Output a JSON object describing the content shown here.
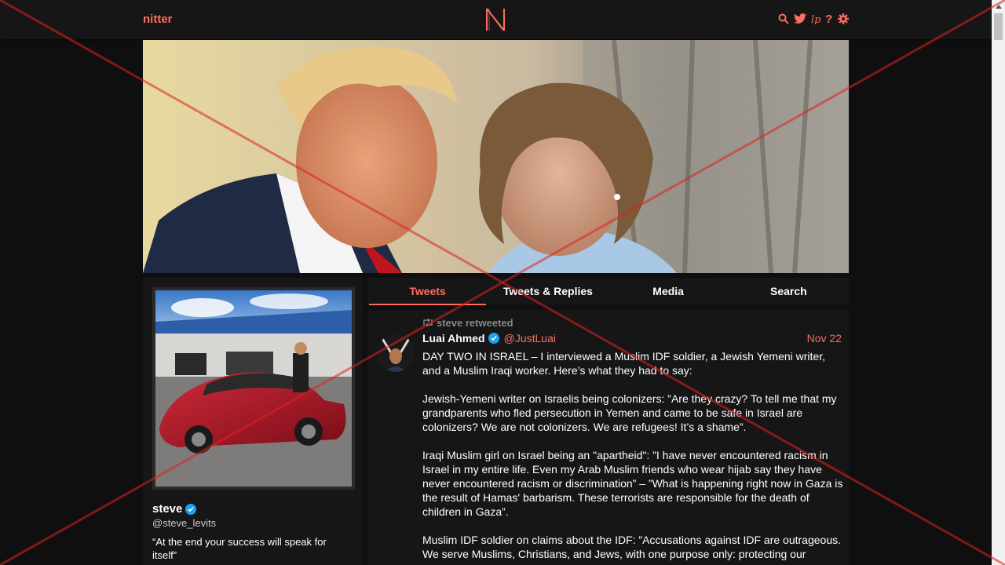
{
  "nav": {
    "brand": "nitter",
    "logo_letter": "N",
    "icons": [
      "search-icon",
      "twitter-icon",
      "liberapay-icon",
      "help-icon",
      "gear-icon"
    ]
  },
  "banner": {},
  "profile": {
    "fullname": "steve",
    "username": "@steve_levits",
    "bio": "“At the end your success will speak for itself”",
    "verified": true
  },
  "tabs": [
    {
      "label": "Tweets",
      "active": true
    },
    {
      "label": "Tweets & Replies",
      "active": false
    },
    {
      "label": "Media",
      "active": false
    },
    {
      "label": "Search",
      "active": false
    }
  ],
  "tweet": {
    "retweet_label": "steve retweeted",
    "fullname": "Luai Ahmed",
    "username": "@JustLuai",
    "date": "Nov 22",
    "verified": true,
    "paragraphs": [
      "DAY TWO IN ISRAEL – I interviewed a Muslim IDF soldier, a Jewish Yemeni writer, and a Muslim Iraqi worker. Here’s what they had to say:",
      "Jewish-Yemeni writer on Israelis being colonizers: ”Are they crazy? To tell me that my grandparents who fled persecution in Yemen and came to be safe in Israel are colonizers? We are not colonizers. We are refugees! It’s a shame”.",
      "Iraqi Muslim girl on Israel being an \"apartheid\": ”I have never encountered racism in Israel in my entire life. Even my Arab Muslim friends who wear hijab say they have never encountered racism or discrimination” – ”What is happening right now in Gaza is the result of Hamas' barbarism. These terrorists are responsible for the death of children in Gaza”.",
      "Muslim IDF soldier on claims about the IDF: ”Accusations against IDF are outrageous. We serve Muslims, Christians, and Jews, with one purpose only: protecting our"
    ]
  },
  "colors": {
    "accent": "#ff6c60",
    "background": "#0f0f0f",
    "panel": "#161616",
    "verified": "#1da1f2"
  }
}
